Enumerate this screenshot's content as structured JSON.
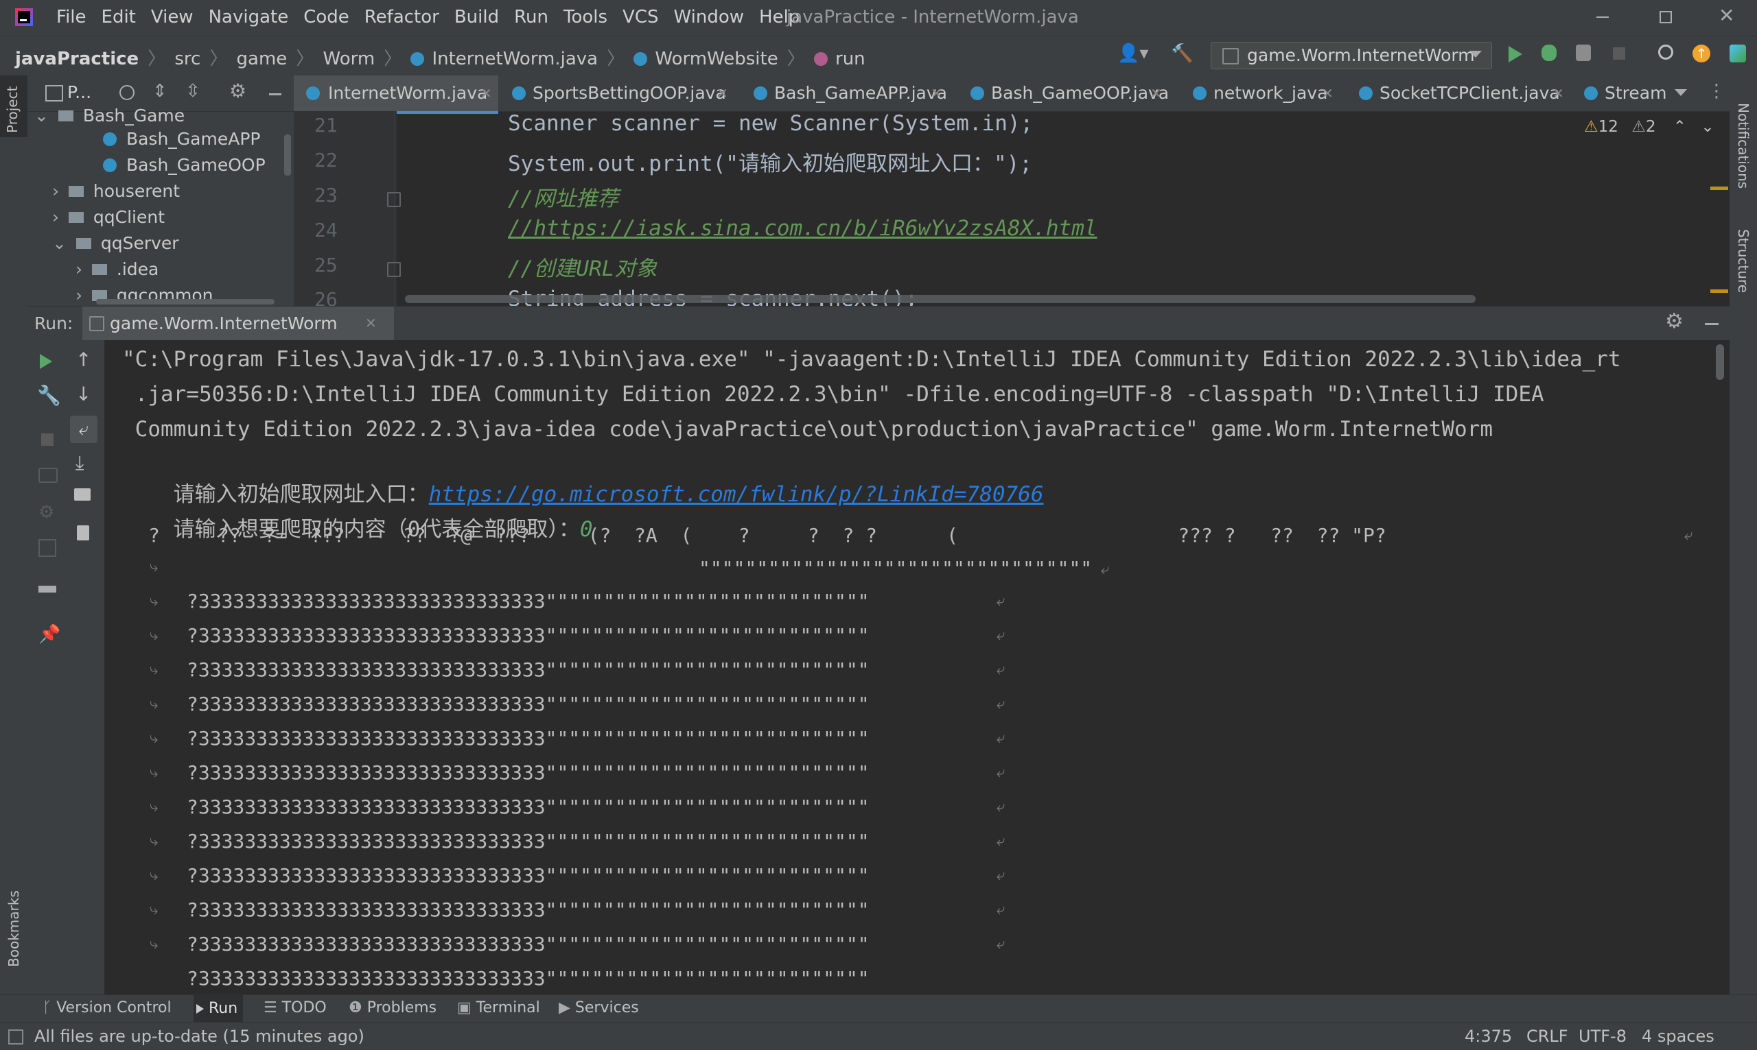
{
  "window": {
    "title": "javaPractice - InternetWorm.java",
    "menu": [
      "File",
      "Edit",
      "View",
      "Navigate",
      "Code",
      "Refactor",
      "Build",
      "Run",
      "Tools",
      "VCS",
      "Window",
      "Help"
    ]
  },
  "breadcrumb": [
    "javaPractice",
    "src",
    "game",
    "Worm",
    "InternetWorm.java",
    "WormWebsite",
    "run"
  ],
  "run_config": "game.Worm.InternetWorm",
  "project_panel": {
    "title": "P...",
    "items": [
      {
        "label": "Bash_Game",
        "kind": "folder-open"
      },
      {
        "label": "Bash_GameAPP",
        "kind": "class"
      },
      {
        "label": "Bash_GameOOP",
        "kind": "class"
      },
      {
        "label": "houserent",
        "kind": "folder"
      },
      {
        "label": "qqClient",
        "kind": "folder"
      },
      {
        "label": "qqServer",
        "kind": "folder-open"
      },
      {
        "label": ".idea",
        "kind": "folder"
      },
      {
        "label": "qqcommon",
        "kind": "folder"
      }
    ]
  },
  "editor": {
    "tabs": [
      "InternetWorm.java",
      "SportsBettingOOP.java",
      "Bash_GameAPP.java",
      "Bash_GameOOP.java",
      "network_java",
      "SocketTCPClient.java",
      "Stream"
    ],
    "warnings": "12",
    "weak_warnings": "2",
    "lines": [
      {
        "num": "21",
        "text": "Scanner scanner = new Scanner(System.in);"
      },
      {
        "num": "22",
        "text": "System.out.print(\"请输入初始爬取网址入口：\");"
      },
      {
        "num": "23",
        "text": "//网址推荐"
      },
      {
        "num": "24",
        "text": "//https://iask.sina.com.cn/b/iR6wYv2zsA8X.html"
      },
      {
        "num": "25",
        "text": "//创建URL对象"
      },
      {
        "num": "26",
        "text": "String address = scanner.next();"
      }
    ]
  },
  "run": {
    "label": "Run:",
    "tab": "game.Worm.InternetWorm",
    "cmd1": "\"C:\\Program Files\\Java\\jdk-17.0.3.1\\bin\\java.exe\" \"-javaagent:D:\\IntelliJ IDEA Community Edition 2022.2.3\\lib\\idea_rt",
    "cmd2": " .jar=50356:D:\\IntelliJ IDEA Community Edition 2022.2.3\\bin\" -Dfile.encoding=UTF-8 -classpath \"D:\\IntelliJ IDEA",
    "cmd3": " Community Edition 2022.2.3\\java-idea code\\javaPractice\\out\\production\\javaPractice\" game.Worm.InternetWorm",
    "prompt1": "请输入初始爬取网址入口：",
    "url": "https://go.microsoft.com/fwlink/p/?LinkId=780766",
    "prompt2": "请输入想要爬取的内容（0代表全部爬取）：",
    "input2": "0",
    "garbage1": "?     ??  ?=  ???     ??  ?@  ???     (?  ?A  (    ?     ?  ? ?      (                   ??? ?   ??  ?? \"P?",
    "garbage2": "\"\"\"\"\"\"\"\"\"\"\"\"\"\"\"\"\"\"\"\"\"\"\"\"\"\"\"\"\"\"\"\"\"\"",
    "repeat_line": "?333333333333333333333333333333\"\"\"\"\"\"\"\"\"\"\"\"\"\"\"\"\"\"\"\"\"\"\"\"\"\"\"\""
  },
  "bottom_tools": [
    "Version Control",
    "Run",
    "TODO",
    "Problems",
    "Terminal",
    "Services"
  ],
  "status": {
    "message": "All files are up-to-date (15 minutes ago)",
    "position": "4:375",
    "line_sep": "CRLF",
    "encoding": "UTF-8",
    "indent": "4 spaces"
  },
  "side_labels": {
    "left_top": "Project",
    "left_bottom": "Bookmarks",
    "right_top": "Notifications",
    "right_mid": "Structure"
  }
}
